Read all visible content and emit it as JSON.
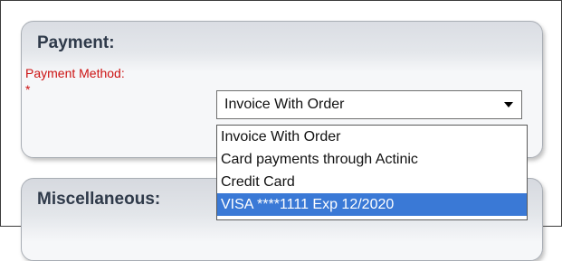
{
  "payment_panel": {
    "title": "Payment:",
    "payment_method": {
      "label": "Payment Method:",
      "required_marker": "*",
      "selected_value": "Invoice With Order",
      "options": [
        "Invoice With Order",
        "Card payments through Actinic",
        "Credit Card",
        "VISA ****1111 Exp 12/2020"
      ],
      "highlighted_option_index": 3
    }
  },
  "misc_panel": {
    "title": "Miscellaneous:"
  },
  "colors": {
    "required_label": "#cc1212",
    "highlight": "#3a79d6",
    "panel_title": "#2f3a4a"
  },
  "icons": {
    "dropdown_toggle": "chevron-down-icon"
  }
}
